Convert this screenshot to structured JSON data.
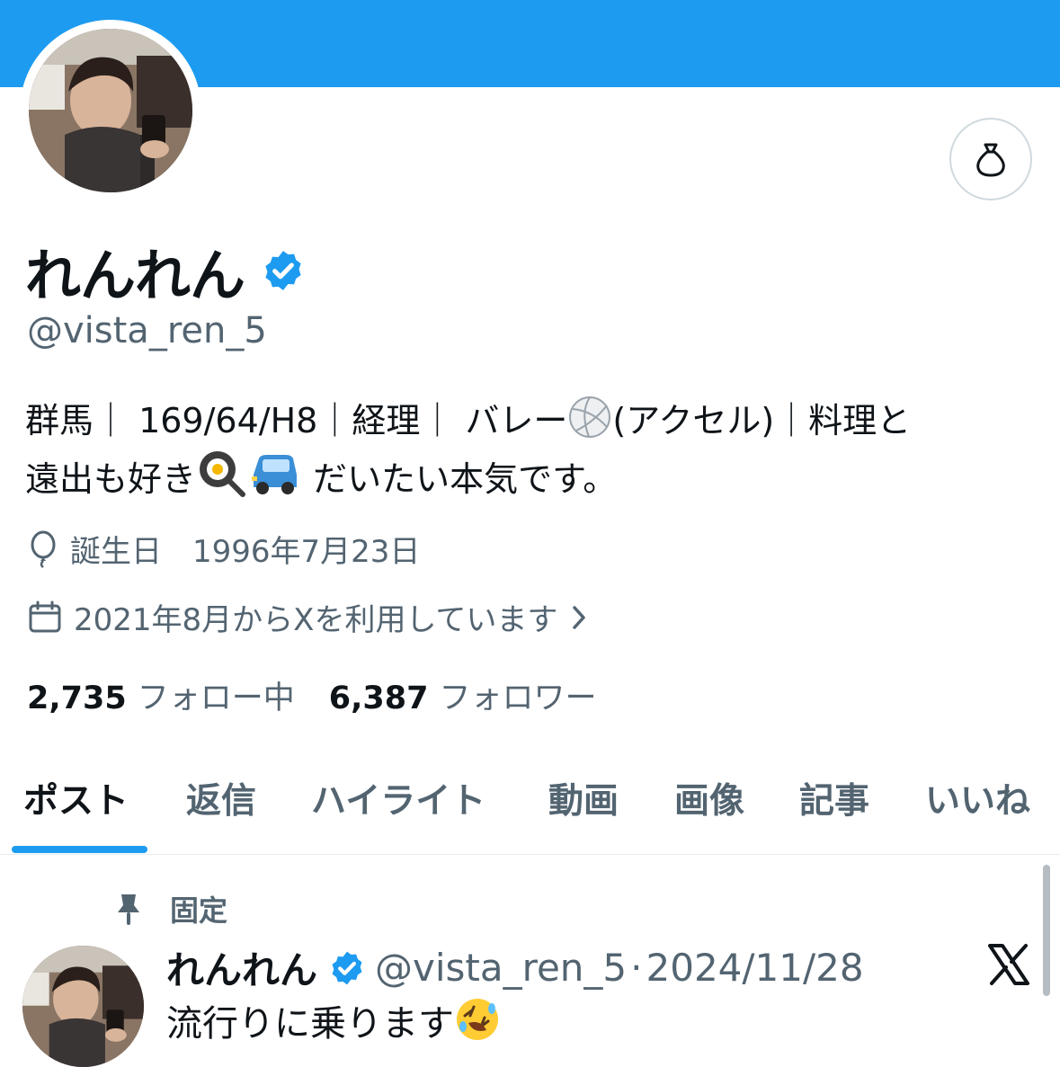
{
  "profile": {
    "display_name": "れんれん",
    "handle": "@vista_ren_5",
    "bio_part1": "群馬｜ 169/64/H8｜経理｜ バレー",
    "bio_part2": "(アクセル)｜料理と",
    "bio_part3": "遠出も好き",
    "bio_part4": " だいたい本気です。",
    "birthday": "誕生日　1996年7月23日",
    "joined": "2021年8月からXを利用しています",
    "following_count": "2,735",
    "following_label": "フォロー中",
    "followers_count": "6,387",
    "followers_label": "フォロワー"
  },
  "tabs": [
    {
      "label": "ポスト",
      "active": true
    },
    {
      "label": "返信"
    },
    {
      "label": "ハイライト"
    },
    {
      "label": "動画"
    },
    {
      "label": "画像"
    },
    {
      "label": "記事"
    },
    {
      "label": "いいね"
    }
  ],
  "pinned_post": {
    "pinned_label": "固定",
    "author_name": "れんれん",
    "author_handle": "@vista_ren_5",
    "separator": "·",
    "date": "2024/11/28",
    "text": "流行りに乗ります"
  },
  "icons": {
    "action_button": "money-bag-icon",
    "birthday": "balloon-icon",
    "joined": "calendar-icon",
    "joined_more": "chevron-right-icon",
    "verified": "verified-badge-icon",
    "pinned": "pin-icon",
    "post_source": "x-logo-icon"
  },
  "colors": {
    "accent": "#1d9bf0",
    "text_primary": "#0f1419",
    "text_secondary": "#536471"
  }
}
